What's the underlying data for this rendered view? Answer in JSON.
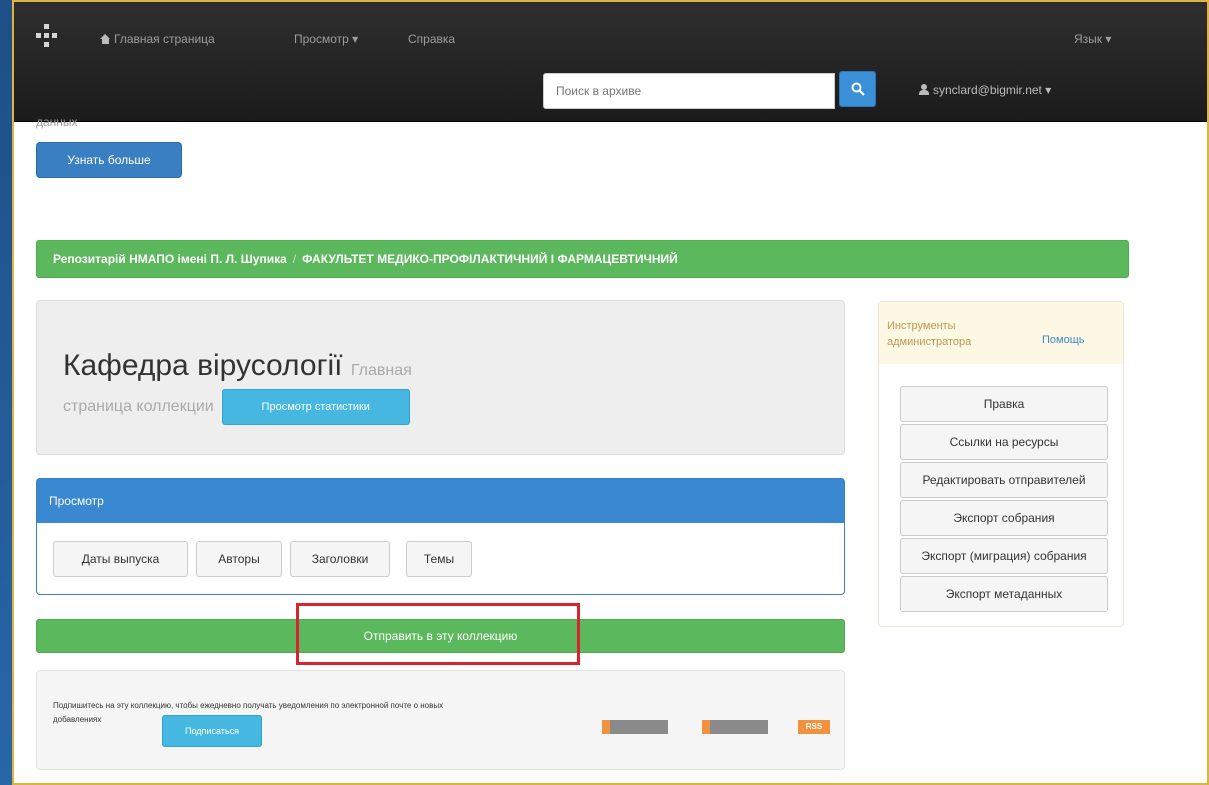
{
  "navbar": {
    "home_label": "Главная страница",
    "browse_label": "Просмотр",
    "help_label": "Справка",
    "language_label": "Язык",
    "search_placeholder": "Поиск в архиве",
    "user_label": "synclard@bigmir.net"
  },
  "hero": {
    "partial_text": "данных",
    "learn_more_label": "Узнать больше"
  },
  "breadcrumb": {
    "root": "Репозитарій НМАПО імені П. Л. Шупика",
    "separator": "/",
    "current": "ФАКУЛЬТЕТ МЕДИКО-ПРОФІЛАКТИЧНИЙ І ФАРМАЦЕВТИЧНИЙ"
  },
  "collection": {
    "title": "Кафедра вірусології",
    "subtitle_part1": "Главная",
    "subtitle_part2": "страница коллекции",
    "stats_button": "Просмотр статистики"
  },
  "browse": {
    "heading": "Просмотр",
    "buttons": [
      "Даты выпуска",
      "Авторы",
      "Заголовки",
      "Темы"
    ]
  },
  "submit": {
    "label": "Отправить в эту коллекцию"
  },
  "subscribe": {
    "text_line1": "Подпишитесь на эту коллекцию, чтобы ежедневно получать уведомления по электронной почте о новых",
    "text_line2": "добавлениях",
    "button": "Подписаться",
    "rss_label": "RSS"
  },
  "admin": {
    "title": "Инструменты администратора",
    "help": "Помощь",
    "items": [
      "Правка",
      "Ссылки на ресурсы",
      "Редактировать отправителей",
      "Экспорт собрания",
      "Экспорт (миграция) собрания",
      "Экспорт метаданных"
    ]
  },
  "colors": {
    "navbar": "#222222",
    "primary": "#3a88d0",
    "success": "#5cb85c",
    "info": "#45b7e0",
    "highlight": "#d9232e",
    "frame_border": "#e0b43c"
  }
}
